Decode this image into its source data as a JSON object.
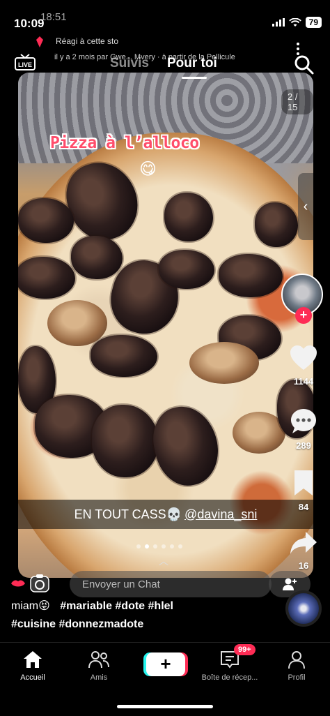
{
  "status_bar": {
    "time": "10:09",
    "time_behind": "18:51",
    "battery": "79"
  },
  "notification": {
    "line1": "Réagi à cette sto",
    "line2": "il y a 2 mois par Gwe... Mvery · à partir de la Pellicule"
  },
  "header": {
    "live_label": "LIVE",
    "tab_following": "Suivis",
    "tab_for_you": "Pour toi"
  },
  "video": {
    "counter": "2 / 15",
    "caption_title": "Pizza à l’alloco",
    "caption_emoji": "😋",
    "subtitle_text": "EN TOUT CASS💀",
    "subtitle_mention": "@davina_sni",
    "slides_total": 6,
    "slide_active": 1
  },
  "actions": {
    "likes": "1144",
    "comments": "289",
    "bookmarks": "84",
    "shares": "16"
  },
  "chat": {
    "placeholder": "Envoyer un Chat"
  },
  "description": {
    "line1_start": "miam😝",
    "line1_tags": "#mariable #dote #hlel",
    "line2_tags": "#cuisine #donnezmadote"
  },
  "bottom_nav": {
    "home": "Accueil",
    "friends": "Amis",
    "inbox": "Boîte de récep...",
    "inbox_badge": "99+",
    "profile": "Profil"
  },
  "colors": {
    "accent_red": "#fe2c55",
    "accent_cyan": "#25f4ee"
  }
}
